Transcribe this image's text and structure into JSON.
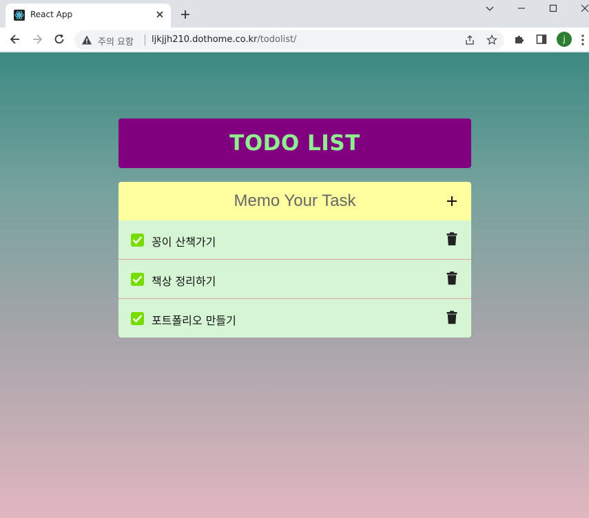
{
  "browser": {
    "tab_title": "React App",
    "security_warning": "주의 요함",
    "url_host": "ljkjjh210.dothome.co.kr",
    "url_path": "/todolist/",
    "profile_initial": "j"
  },
  "app": {
    "title": "TODO LIST",
    "input_placeholder": "Memo Your Task",
    "colors": {
      "title_bg": "#800080",
      "title_text": "#90ee90",
      "input_bg": "#ffffa0",
      "item_bg": "#d5f5d5",
      "check": "#77dd00"
    },
    "todos": [
      {
        "text": "꽁이 산책가기",
        "done": true
      },
      {
        "text": "책상 정리하기",
        "done": true
      },
      {
        "text": "포트폴리오 만들기",
        "done": true
      }
    ]
  }
}
